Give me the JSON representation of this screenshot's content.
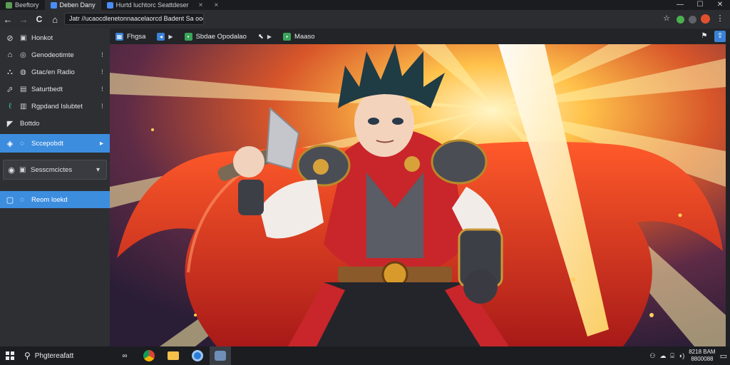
{
  "tabs": [
    {
      "label": "Beeftory",
      "active": false
    },
    {
      "label": "Deben Dany",
      "active": true
    },
    {
      "label": "Hurtd luchtorc Seattdeser",
      "active": false
    }
  ],
  "window": {
    "minimize": "—",
    "maximize": "☐",
    "close": "✕"
  },
  "toolbar": {
    "back": "←",
    "forward": "→",
    "reload": "C",
    "home": "⌂",
    "address": "Jatr //ucaocdlenetonnaacelaorcd Badent Sa oooad",
    "star_icon": "☆"
  },
  "sidebar": {
    "items": [
      {
        "label": "Honkot"
      },
      {
        "label": "Genodeotimte"
      },
      {
        "label": "Gtac/en Radio"
      },
      {
        "label": "Saturtbedt"
      },
      {
        "label": "Rgpdand Islubtet"
      },
      {
        "label": "Bottdo"
      },
      {
        "label": "Sccepobdt"
      },
      {
        "label": "Sesscmcictes"
      },
      {
        "label": "Reom loekd"
      }
    ]
  },
  "bookmarks": [
    {
      "label": "Fhgsa"
    },
    {
      "label": "Sbdae Opodalao"
    },
    {
      "label": "Maaso"
    }
  ],
  "content": {
    "caption": ""
  },
  "taskbar": {
    "search_label": "Phgtereafatt",
    "clock_time": "8218 BAM",
    "clock_date": "8800088"
  },
  "colors": {
    "accent": "#3d8ddf",
    "taskbar": "#1c1d21",
    "sidebar": "#2d2f33"
  }
}
